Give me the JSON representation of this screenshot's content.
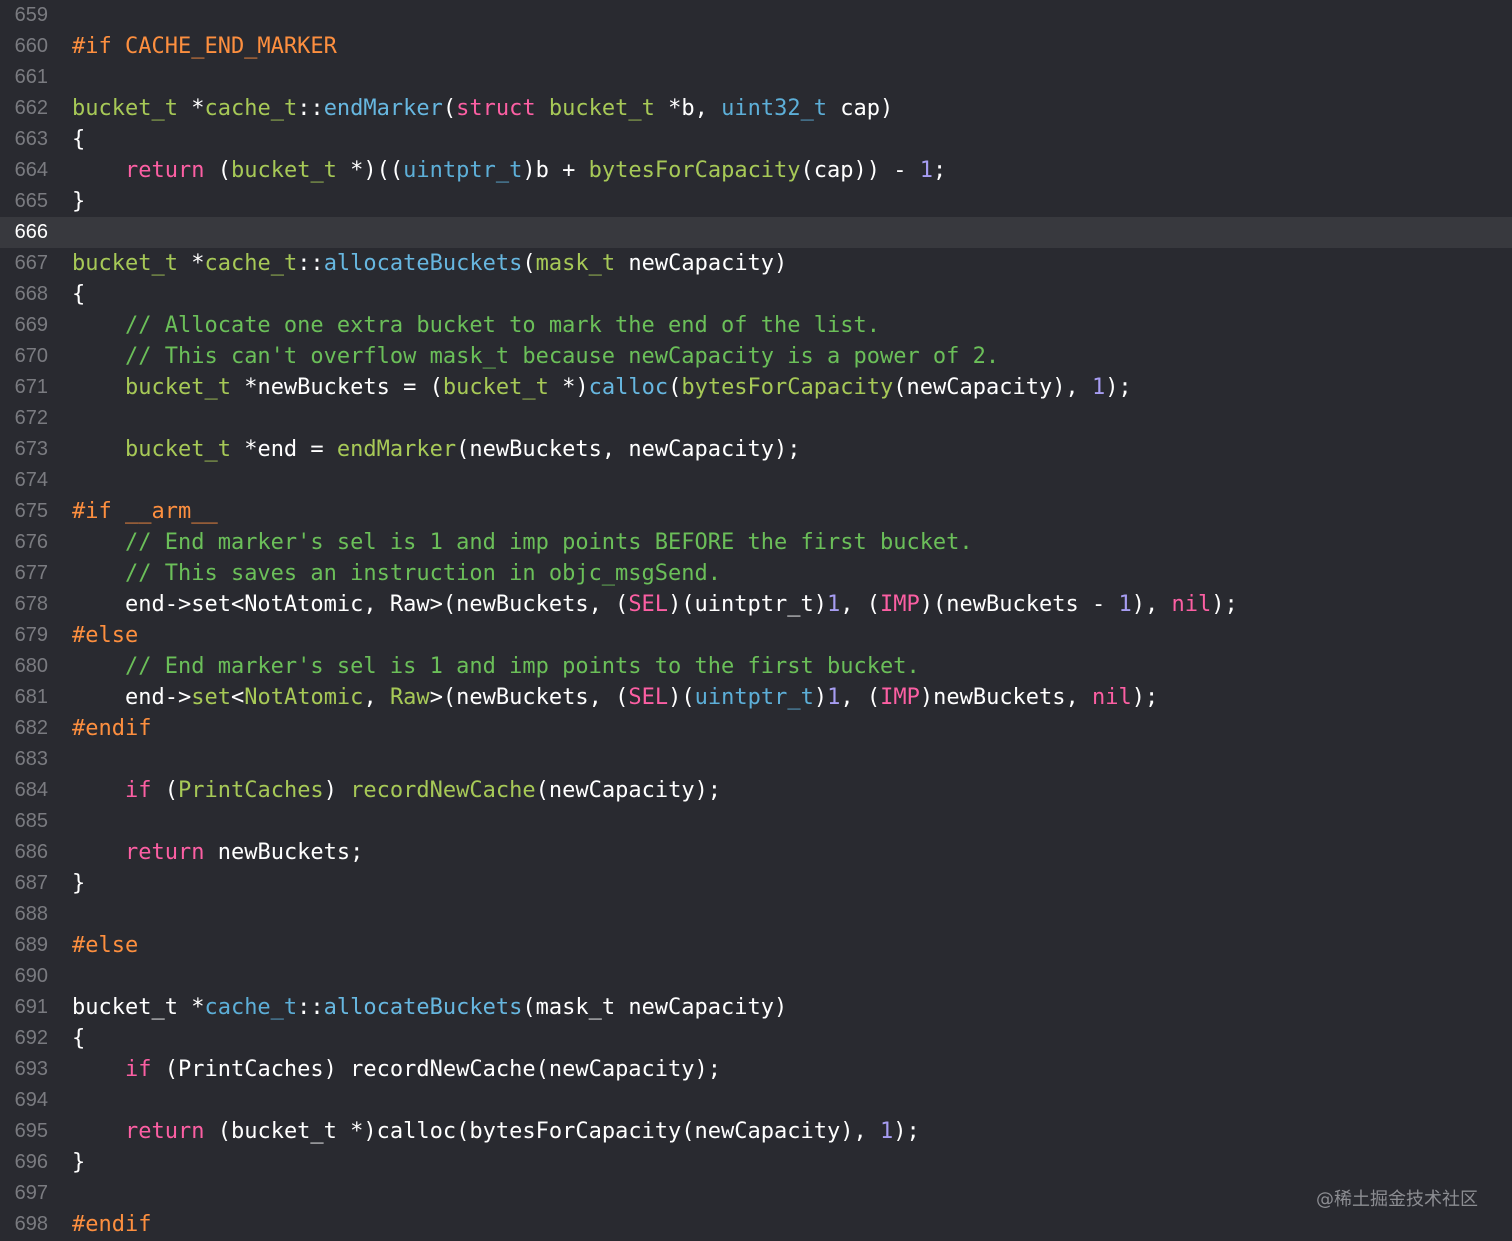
{
  "colors": {
    "background": "#292a30",
    "current_line": "#38393e",
    "line_number": "#7a7b80",
    "plain": "#ffffff",
    "keyword": "#ff7ab2",
    "type": "#dabaff",
    "function": "#b281eb",
    "project": "#acf2e4",
    "preprocessor": "#ffa14f",
    "comment": "#7f8c98",
    "number": "#d9c97c",
    "string": "#ff8170"
  },
  "current_line": "666",
  "lines": [
    {
      "n": "659",
      "tokens": []
    },
    {
      "n": "660",
      "tokens": [
        [
          "#if CACHE_END_MARKER",
          "pp"
        ]
      ]
    },
    {
      "n": "661",
      "tokens": []
    },
    {
      "n": "662",
      "tokens": [
        [
          "bucket_t",
          "ty"
        ],
        [
          " *",
          "pl"
        ],
        [
          "cache_t",
          "ty"
        ],
        [
          "::",
          "pl"
        ],
        [
          "endMarker",
          "fn"
        ],
        [
          "(",
          "pl"
        ],
        [
          "struct",
          "kw"
        ],
        [
          " ",
          "pl"
        ],
        [
          "bucket_t",
          "ty"
        ],
        [
          " *b, ",
          "pl"
        ],
        [
          "uint32_t",
          "sy"
        ],
        [
          " cap)",
          "pl"
        ]
      ]
    },
    {
      "n": "663",
      "tokens": [
        [
          "{",
          "pl"
        ]
      ]
    },
    {
      "n": "664",
      "tokens": [
        [
          "    ",
          "pl"
        ],
        [
          "return",
          "kw"
        ],
        [
          " (",
          "pl"
        ],
        [
          "bucket_t",
          "ty"
        ],
        [
          " *)((",
          "pl"
        ],
        [
          "uintptr_t",
          "sy"
        ],
        [
          ")b + ",
          "pl"
        ],
        [
          "bytesForCapacity",
          "ty"
        ],
        [
          "(cap)) - ",
          "pl"
        ],
        [
          "1",
          "nu"
        ],
        [
          ";",
          "pl"
        ]
      ]
    },
    {
      "n": "665",
      "tokens": [
        [
          "}",
          "pl"
        ]
      ]
    },
    {
      "n": "666",
      "tokens": []
    },
    {
      "n": "667",
      "tokens": [
        [
          "bucket_t",
          "ty"
        ],
        [
          " *",
          "pl"
        ],
        [
          "cache_t",
          "ty"
        ],
        [
          "::",
          "pl"
        ],
        [
          "allocateBuckets",
          "fn"
        ],
        [
          "(",
          "pl"
        ],
        [
          "mask_t",
          "ty"
        ],
        [
          " newCapacity)",
          "pl"
        ]
      ]
    },
    {
      "n": "668",
      "tokens": [
        [
          "{",
          "pl"
        ]
      ]
    },
    {
      "n": "669",
      "tokens": [
        [
          "    ",
          "pl"
        ],
        [
          "// Allocate one extra bucket to mark the end of the list.",
          "cm"
        ]
      ]
    },
    {
      "n": "670",
      "tokens": [
        [
          "    ",
          "pl"
        ],
        [
          "// This can't overflow mask_t because newCapacity is a power of 2.",
          "cm"
        ]
      ]
    },
    {
      "n": "671",
      "tokens": [
        [
          "    ",
          "pl"
        ],
        [
          "bucket_t",
          "ty"
        ],
        [
          " *newBuckets = (",
          "pl"
        ],
        [
          "bucket_t",
          "ty"
        ],
        [
          " *)",
          "pl"
        ],
        [
          "calloc",
          "fn"
        ],
        [
          "(",
          "pl"
        ],
        [
          "bytesForCapacity",
          "ty"
        ],
        [
          "(newCapacity), ",
          "pl"
        ],
        [
          "1",
          "nu"
        ],
        [
          ");",
          "pl"
        ]
      ]
    },
    {
      "n": "672",
      "tokens": []
    },
    {
      "n": "673",
      "tokens": [
        [
          "    ",
          "pl"
        ],
        [
          "bucket_t",
          "ty"
        ],
        [
          " *end = ",
          "pl"
        ],
        [
          "endMarker",
          "ty"
        ],
        [
          "(newBuckets, newCapacity);",
          "pl"
        ]
      ]
    },
    {
      "n": "674",
      "tokens": []
    },
    {
      "n": "675",
      "tokens": [
        [
          "#if __arm__",
          "pp"
        ]
      ]
    },
    {
      "n": "676",
      "tokens": [
        [
          "    ",
          "pl"
        ],
        [
          "// End marker's sel is 1 and imp points BEFORE the first bucket.",
          "cm"
        ]
      ]
    },
    {
      "n": "677",
      "tokens": [
        [
          "    ",
          "pl"
        ],
        [
          "// This saves an instruction in objc_msgSend.",
          "cm"
        ]
      ]
    },
    {
      "n": "678",
      "tokens": [
        [
          "    ",
          "pl"
        ],
        [
          "end->set<NotAtomic, Raw>(newBuckets, (",
          "pl"
        ],
        [
          "SEL",
          "kw"
        ],
        [
          ")(uintptr_t)",
          "pl"
        ],
        [
          "1",
          "nu"
        ],
        [
          ", (",
          "pl"
        ],
        [
          "IMP",
          "kw"
        ],
        [
          ")(newBuckets - ",
          "pl"
        ],
        [
          "1",
          "nu"
        ],
        [
          "), ",
          "pl"
        ],
        [
          "nil",
          "kw"
        ],
        [
          ");",
          "pl"
        ]
      ]
    },
    {
      "n": "679",
      "tokens": [
        [
          "#else",
          "pp"
        ]
      ]
    },
    {
      "n": "680",
      "tokens": [
        [
          "    ",
          "pl"
        ],
        [
          "// End marker's sel is 1 and imp points to the first bucket.",
          "cm"
        ]
      ]
    },
    {
      "n": "681",
      "tokens": [
        [
          "    ",
          "pl"
        ],
        [
          "end->",
          "pl"
        ],
        [
          "set",
          "ty"
        ],
        [
          "<",
          "pl"
        ],
        [
          "NotAtomic",
          "ty"
        ],
        [
          ", ",
          "pl"
        ],
        [
          "Raw",
          "ty"
        ],
        [
          ">(newBuckets, (",
          "pl"
        ],
        [
          "SEL",
          "kw"
        ],
        [
          ")(",
          "pl"
        ],
        [
          "uintptr_t",
          "sy"
        ],
        [
          ")",
          "pl"
        ],
        [
          "1",
          "nu"
        ],
        [
          ", (",
          "pl"
        ],
        [
          "IMP",
          "kw"
        ],
        [
          ")newBuckets, ",
          "pl"
        ],
        [
          "nil",
          "kw"
        ],
        [
          ");",
          "pl"
        ]
      ]
    },
    {
      "n": "682",
      "tokens": [
        [
          "#endif",
          "pp"
        ]
      ]
    },
    {
      "n": "683",
      "tokens": []
    },
    {
      "n": "684",
      "tokens": [
        [
          "    ",
          "pl"
        ],
        [
          "if",
          "kw"
        ],
        [
          " (",
          "pl"
        ],
        [
          "PrintCaches",
          "ty"
        ],
        [
          ") ",
          "pl"
        ],
        [
          "recordNewCache",
          "ty"
        ],
        [
          "(newCapacity);",
          "pl"
        ]
      ]
    },
    {
      "n": "685",
      "tokens": []
    },
    {
      "n": "686",
      "tokens": [
        [
          "    ",
          "pl"
        ],
        [
          "return",
          "kw"
        ],
        [
          " newBuckets;",
          "pl"
        ]
      ]
    },
    {
      "n": "687",
      "tokens": [
        [
          "}",
          "pl"
        ]
      ]
    },
    {
      "n": "688",
      "tokens": []
    },
    {
      "n": "689",
      "tokens": [
        [
          "#else",
          "pp"
        ]
      ]
    },
    {
      "n": "690",
      "tokens": []
    },
    {
      "n": "691",
      "tokens": [
        [
          "bucket_t *",
          "pl"
        ],
        [
          "cache_t",
          "sy"
        ],
        [
          "::",
          "pl"
        ],
        [
          "allocateBuckets",
          "fn"
        ],
        [
          "(mask_t newCapacity)",
          "pl"
        ]
      ]
    },
    {
      "n": "692",
      "tokens": [
        [
          "{",
          "pl"
        ]
      ]
    },
    {
      "n": "693",
      "tokens": [
        [
          "    ",
          "pl"
        ],
        [
          "if",
          "kw"
        ],
        [
          " (PrintCaches) recordNewCache(newCapacity);",
          "pl"
        ]
      ]
    },
    {
      "n": "694",
      "tokens": []
    },
    {
      "n": "695",
      "tokens": [
        [
          "    ",
          "pl"
        ],
        [
          "return",
          "kw"
        ],
        [
          " (bucket_t *)calloc(bytesForCapacity(newCapacity), ",
          "pl"
        ],
        [
          "1",
          "nu"
        ],
        [
          ");",
          "pl"
        ]
      ]
    },
    {
      "n": "696",
      "tokens": [
        [
          "}",
          "pl"
        ]
      ]
    },
    {
      "n": "697",
      "tokens": []
    },
    {
      "n": "698",
      "tokens": [
        [
          "#endif",
          "pp"
        ]
      ]
    }
  ],
  "token_colors": {
    "pl": "#ffffff",
    "pp": "#fd8f3f",
    "ty": "#a7c957",
    "fn": "#67b7e0",
    "kw": "#fc5fa3",
    "sy": "#5dafd8",
    "cm": "#6bbf59",
    "nu": "#a79df2"
  },
  "watermark": "@稀土掘金技术社区"
}
